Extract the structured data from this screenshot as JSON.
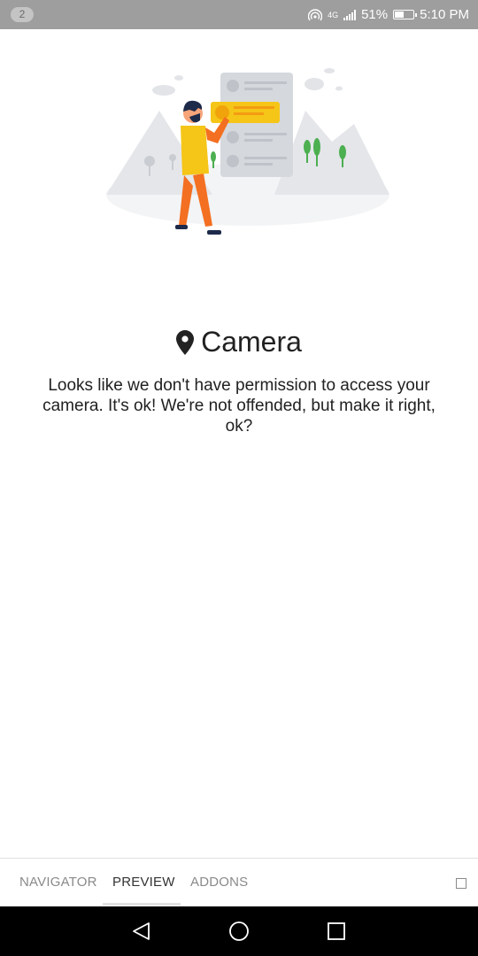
{
  "status_bar": {
    "notification_count": "2",
    "network_label": "4G",
    "battery_percent": "51%",
    "time": "5:10 PM"
  },
  "illustration": {
    "icon": "person-with-list-illustration"
  },
  "permission": {
    "icon": "location-pin-icon",
    "title": "Camera",
    "message": "Looks like we don't have permission to access your camera. It's ok! We're not offended, but make it right, ok?"
  },
  "tabs": [
    {
      "label": "NAVIGATOR",
      "active": false
    },
    {
      "label": "PREVIEW",
      "active": true
    },
    {
      "label": "ADDONS",
      "active": false
    }
  ],
  "nav": {
    "back_icon": "back-triangle-icon",
    "home_icon": "home-circle-icon",
    "recents_icon": "recents-square-icon"
  },
  "colors": {
    "status_bar": "#9e9e9e",
    "accent_yellow": "#f5c518",
    "accent_orange": "#f36f21",
    "nav_bar": "#000000"
  }
}
